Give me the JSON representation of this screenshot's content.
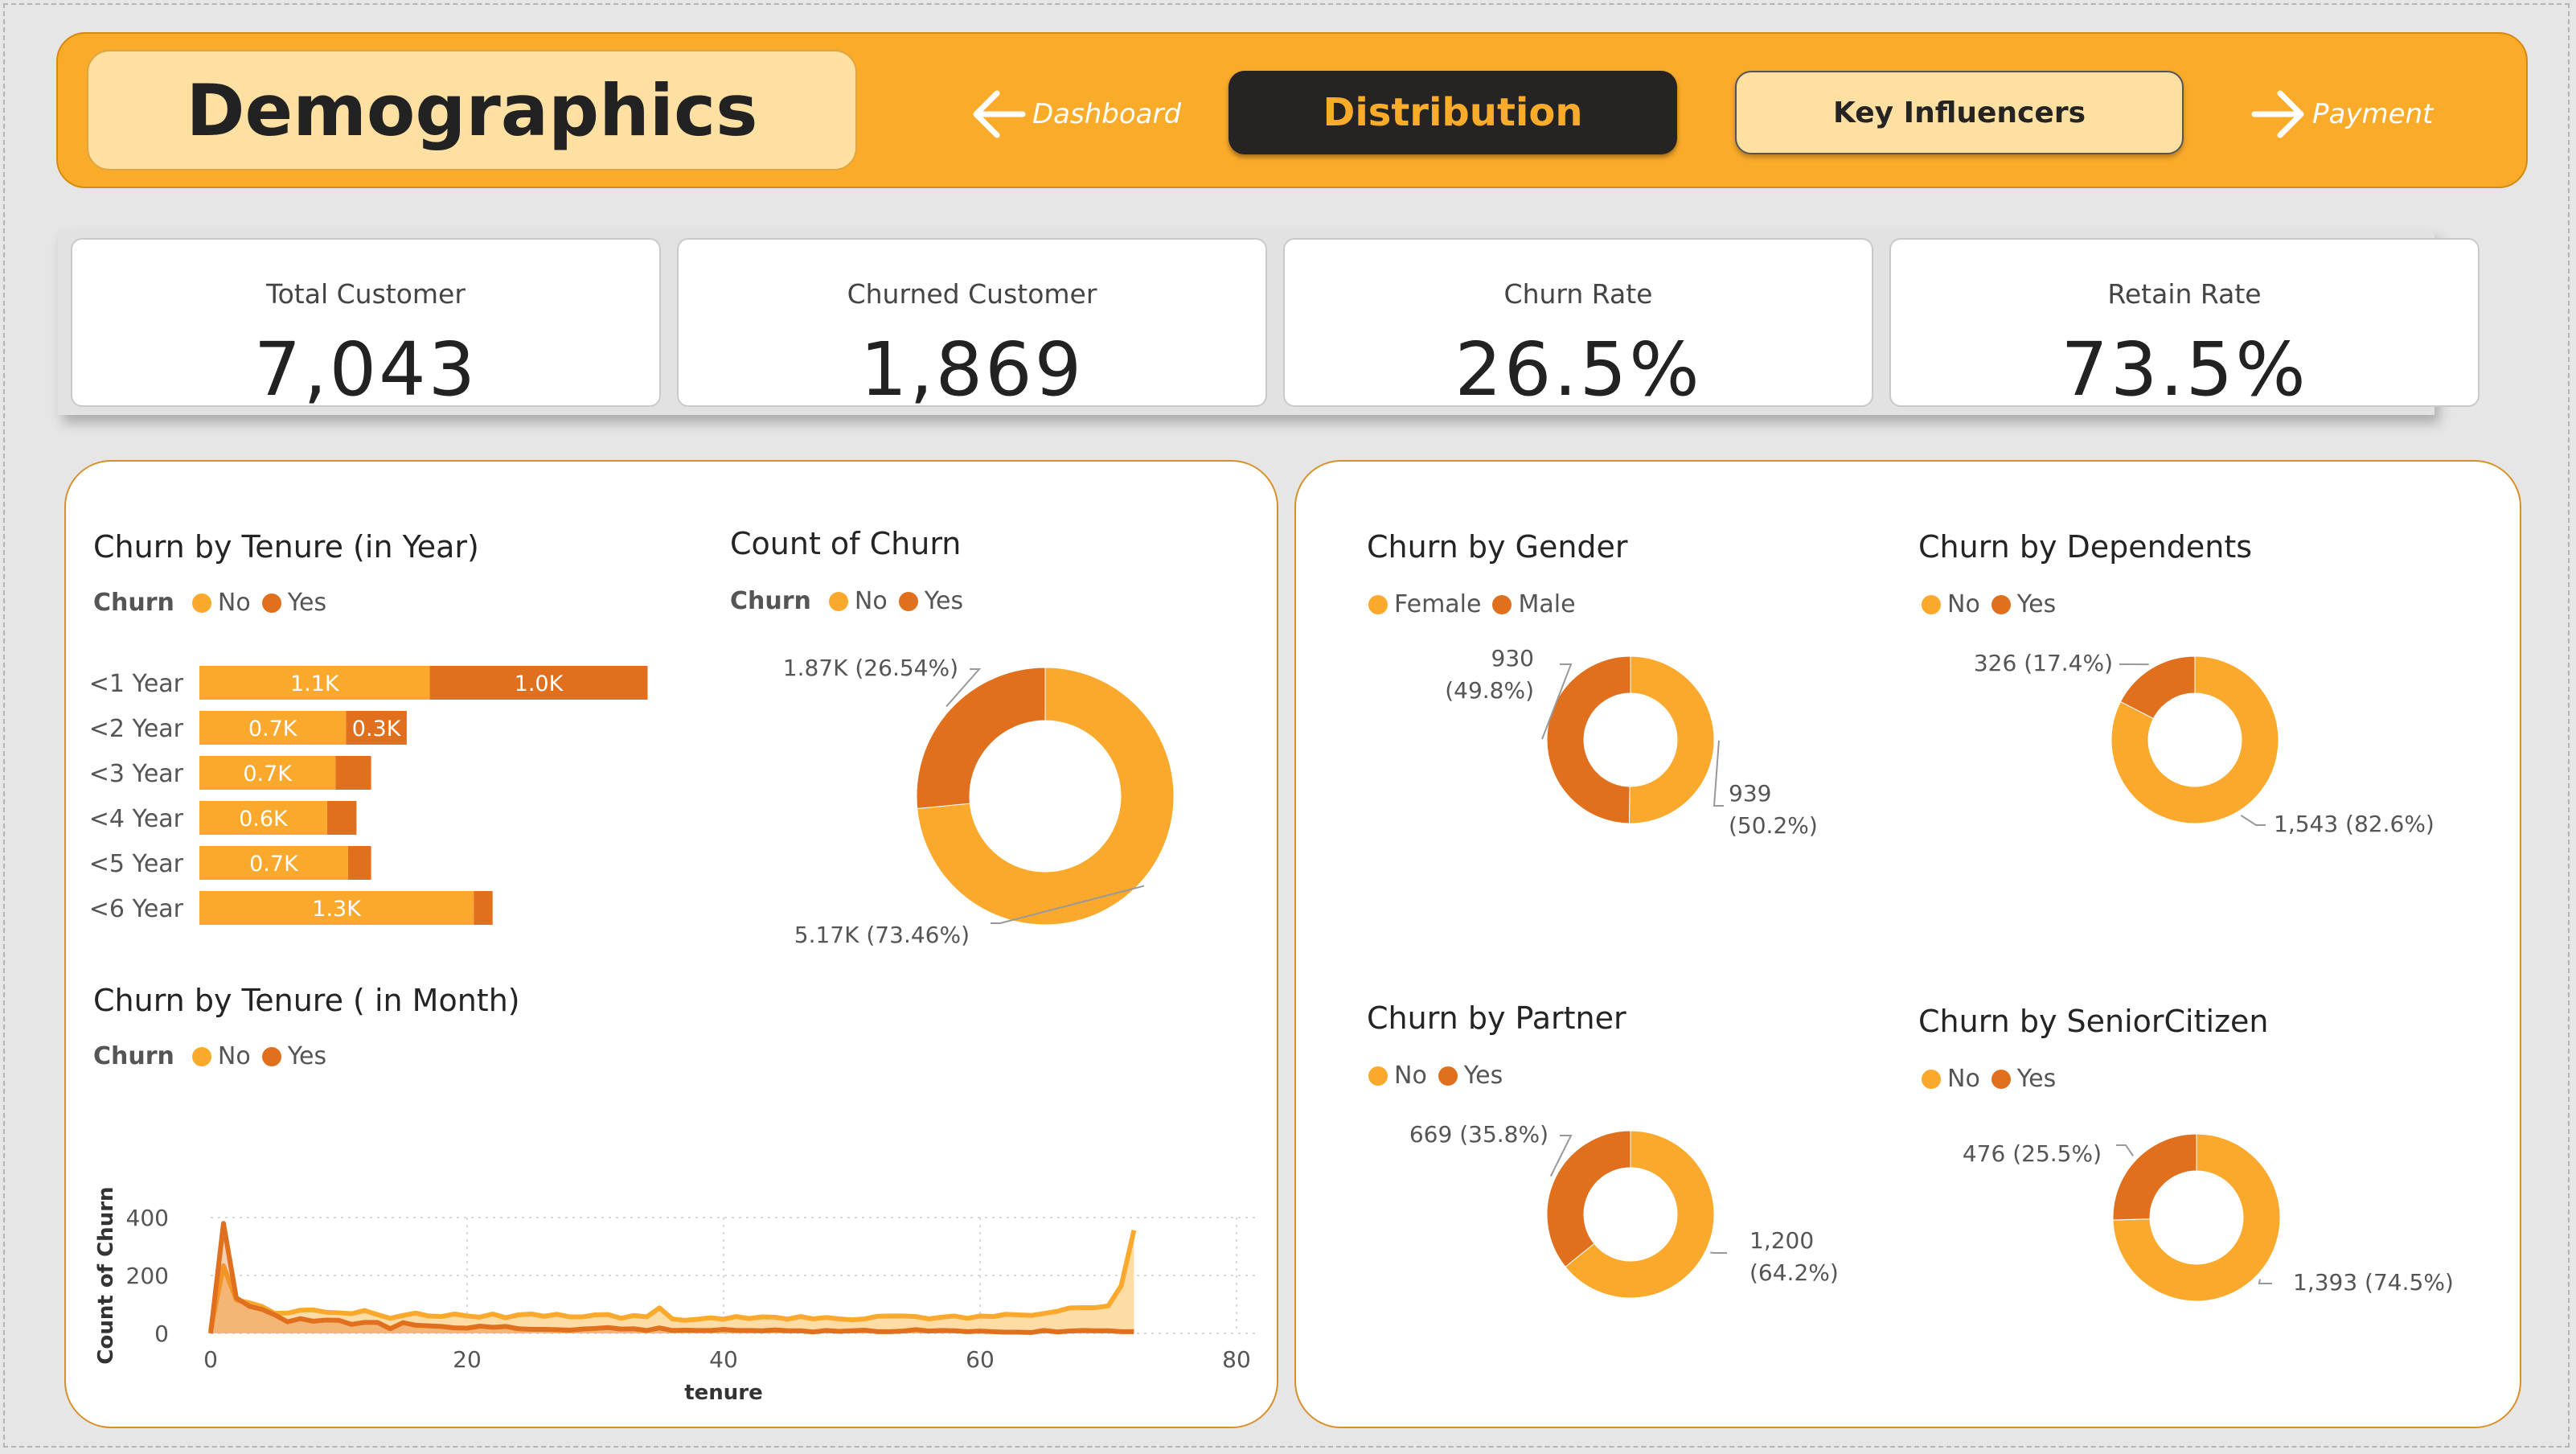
{
  "header": {
    "title": "Demographics",
    "nav_prev": "Dashboard",
    "btn_active": "Distribution",
    "btn_other": "Key Influencers",
    "nav_next": "Payment"
  },
  "kpis": [
    {
      "label": "Total Customer",
      "value": "7,043"
    },
    {
      "label": "Churned Customer",
      "value": "1,869"
    },
    {
      "label": "Churn Rate",
      "value": "26.5%"
    },
    {
      "label": "Retain Rate",
      "value": "73.5%"
    }
  ],
  "colors": {
    "no": "#fba92c",
    "yes": "#e1701e",
    "no_area": "#fdd696",
    "accent": "#fbab2a"
  },
  "legend": {
    "title": "Churn",
    "no": "No",
    "yes": "Yes",
    "female": "Female",
    "male": "Male"
  },
  "chart_data": [
    {
      "id": "tenure_year",
      "type": "bar",
      "orientation": "horizontal",
      "stacked": true,
      "title": "Churn by Tenure (in Year)",
      "legend_title": "Churn",
      "categories": [
        "<1 Year",
        "<2 Year",
        "<3 Year",
        "<4 Year",
        "<5 Year",
        "<6 Year"
      ],
      "series": [
        {
          "name": "No",
          "values": [
            1100,
            700,
            650,
            610,
            710,
            1310
          ],
          "labels": [
            "1.1K",
            "0.7K",
            "0.7K",
            "0.6K",
            "0.7K",
            "1.3K"
          ]
        },
        {
          "name": "Yes",
          "values": [
            1040,
            290,
            170,
            140,
            110,
            90
          ],
          "labels": [
            "1.0K",
            "0.3K",
            "",
            "",
            "",
            ""
          ]
        }
      ]
    },
    {
      "id": "count_churn",
      "type": "pie",
      "donut": true,
      "title": "Count of Churn",
      "legend_title": "Churn",
      "slices": [
        {
          "name": "No",
          "value": 5174,
          "label": "5.17K (73.46%)"
        },
        {
          "name": "Yes",
          "value": 1869,
          "label": "1.87K (26.54%)"
        }
      ]
    },
    {
      "id": "tenure_month",
      "type": "area",
      "title": "Churn by Tenure ( in Month)",
      "legend_title": "Churn",
      "xlabel": "tenure",
      "ylabel": "Count of Churn",
      "xlim": [
        0,
        80
      ],
      "ylim": [
        0,
        400
      ],
      "xticks": [
        0,
        20,
        40,
        60,
        80
      ],
      "yticks": [
        0,
        200,
        400
      ],
      "x": [
        0,
        1,
        2,
        3,
        4,
        5,
        6,
        7,
        8,
        9,
        10,
        11,
        12,
        13,
        14,
        15,
        16,
        17,
        18,
        19,
        20,
        21,
        22,
        23,
        24,
        25,
        26,
        27,
        28,
        29,
        30,
        31,
        32,
        33,
        34,
        35,
        36,
        37,
        38,
        39,
        40,
        41,
        42,
        43,
        44,
        45,
        46,
        47,
        48,
        49,
        50,
        51,
        52,
        53,
        54,
        55,
        56,
        57,
        58,
        59,
        60,
        61,
        62,
        63,
        64,
        65,
        66,
        67,
        68,
        69,
        70,
        71,
        72
      ],
      "series": [
        {
          "name": "No",
          "values": [
            11,
            233,
            115,
            106,
            93,
            69,
            70,
            80,
            81,
            73,
            71,
            68,
            79,
            65,
            52,
            62,
            70,
            60,
            58,
            67,
            60,
            56,
            67,
            54,
            64,
            67,
            59,
            66,
            57,
            57,
            64,
            65,
            52,
            62,
            57,
            88,
            50,
            45,
            49,
            54,
            49,
            58,
            51,
            57,
            56,
            49,
            58,
            50,
            55,
            50,
            47,
            50,
            59,
            60,
            60,
            58,
            50,
            56,
            60,
            52,
            60,
            58,
            66,
            64,
            62,
            69,
            76,
            88,
            89,
            89,
            95,
            164,
            356
          ]
        },
        {
          "name": "Yes",
          "values": [
            0,
            380,
            123,
            94,
            83,
            64,
            40,
            51,
            42,
            46,
            45,
            31,
            38,
            38,
            16,
            37,
            28,
            26,
            24,
            19,
            18,
            25,
            21,
            24,
            16,
            14,
            14,
            13,
            11,
            15,
            17,
            20,
            15,
            16,
            10,
            19,
            10,
            11,
            10,
            10,
            14,
            10,
            10,
            9,
            12,
            9,
            9,
            5,
            10,
            7,
            9,
            11,
            6,
            6,
            8,
            13,
            8,
            10,
            9,
            6,
            8,
            6,
            4,
            4,
            3,
            10,
            5,
            8,
            10,
            9,
            9,
            6,
            6
          ]
        }
      ]
    },
    {
      "id": "gender",
      "type": "pie",
      "donut": true,
      "title": "Churn by Gender",
      "slices": [
        {
          "name": "Female",
          "value": 939,
          "label": [
            "939",
            "(50.2%)"
          ]
        },
        {
          "name": "Male",
          "value": 930,
          "label": [
            "930",
            "(49.8%)"
          ]
        }
      ]
    },
    {
      "id": "dependents",
      "type": "pie",
      "donut": true,
      "title": "Churn by Dependents",
      "slices": [
        {
          "name": "No",
          "value": 1543,
          "label": [
            "1,543 (82.6%)"
          ]
        },
        {
          "name": "Yes",
          "value": 326,
          "label": [
            "326 (17.4%)"
          ]
        }
      ]
    },
    {
      "id": "partner",
      "type": "pie",
      "donut": true,
      "title": "Churn by Partner",
      "slices": [
        {
          "name": "No",
          "value": 1200,
          "label": [
            "1,200",
            "(64.2%)"
          ]
        },
        {
          "name": "Yes",
          "value": 669,
          "label": [
            "669 (35.8%)"
          ]
        }
      ]
    },
    {
      "id": "senior",
      "type": "pie",
      "donut": true,
      "title": "Churn by SeniorCitizen",
      "slices": [
        {
          "name": "No",
          "value": 1393,
          "label": [
            "1,393 (74.5%)"
          ]
        },
        {
          "name": "Yes",
          "value": 476,
          "label": [
            "476 (25.5%)"
          ]
        }
      ]
    }
  ]
}
